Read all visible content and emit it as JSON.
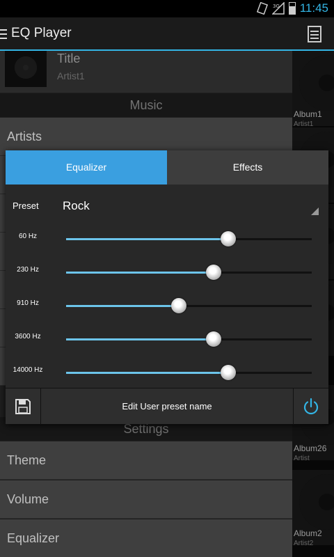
{
  "status": {
    "time": "11:45",
    "network": "3G"
  },
  "actionbar": {
    "title": "EQ Player"
  },
  "nowplaying": {
    "title": "Title",
    "artist": "Artist1"
  },
  "sections": {
    "music": "Music",
    "settings": "Settings"
  },
  "music_items": [
    "Artists"
  ],
  "settings_items": [
    "Theme",
    "Volume",
    "Equalizer"
  ],
  "albums": [
    {
      "name": "Album1",
      "artist": "Artist1"
    },
    {
      "name": "Album26",
      "artist": "Artist"
    },
    {
      "name": "Album2",
      "artist": "Artist2"
    }
  ],
  "dialog": {
    "tabs": {
      "equalizer": "Equalizer",
      "effects": "Effects",
      "active": "equalizer"
    },
    "preset_label": "Preset",
    "preset_value": "Rock",
    "bands": [
      {
        "label": "60 Hz",
        "level": 0.66
      },
      {
        "label": "230 Hz",
        "level": 0.6
      },
      {
        "label": "910 Hz",
        "level": 0.46
      },
      {
        "label": "3600 Hz",
        "level": 0.6
      },
      {
        "label": "14000 Hz",
        "level": 0.66
      }
    ],
    "edit_label": "Edit User preset name"
  },
  "colors": {
    "accent": "#33b5e5",
    "tab_active": "#3a9fe0",
    "slider_fill": "#6cc4ea"
  }
}
